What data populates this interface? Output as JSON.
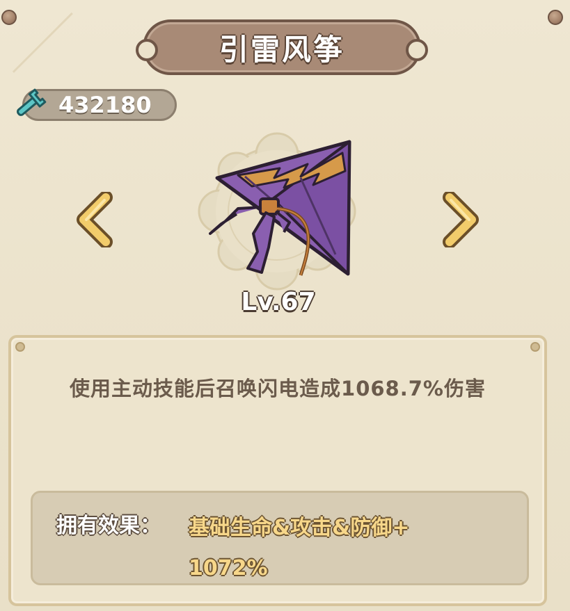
{
  "title": "引雷风筝",
  "currency": {
    "amount": "432180",
    "icon": "wrench-icon"
  },
  "item": {
    "name": "kite",
    "level": "Lv.67",
    "icon": "purple-lightning-kite"
  },
  "navigation": {
    "prev_icon": "chevron-left-icon",
    "next_icon": "chevron-right-icon"
  },
  "description": "使用主动技能后召唤闪电造成1068.7%伤害",
  "owned_effect": {
    "label": "拥有效果：",
    "value_line1": "基础生命&攻击&防御+",
    "value_line2": "1072%"
  },
  "colors": {
    "title_plate": "#a88a76",
    "accent_gold": "#f7d78a",
    "kite_purple": "#8a5fb0",
    "wrench_teal": "#5cc6c6"
  }
}
